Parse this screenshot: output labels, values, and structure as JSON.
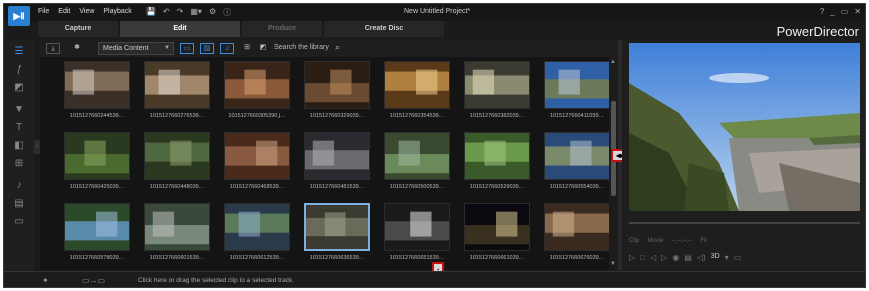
{
  "titlebar": {
    "logo": "▶Ⅱ",
    "menu": [
      "File",
      "Edit",
      "View",
      "Playback"
    ],
    "icons": [
      "💾",
      "↶",
      "↷",
      "▦▾",
      "⚙",
      "ⓘ"
    ],
    "project_title": "New Untitled Project*",
    "window_controls": [
      "?",
      "_",
      "▭",
      "✕"
    ]
  },
  "mode_tabs": [
    {
      "label": "Capture",
      "state": "normal"
    },
    {
      "label": "Edit",
      "state": "active"
    },
    {
      "label": "Produce",
      "state": "disabled"
    },
    {
      "label": "Create Disc",
      "state": "normal"
    }
  ],
  "brand": "PowerDirector",
  "library": {
    "content_type": "Media Content",
    "search_placeholder": "Search the library",
    "media": [
      {
        "caption": "1015127660244539…"
      },
      {
        "caption": "1015127660276539…"
      },
      {
        "caption": "1015127660305390.j…"
      },
      {
        "caption": "1015127660329039…"
      },
      {
        "caption": "1015127660354539…"
      },
      {
        "caption": "1015127660382039…"
      },
      {
        "caption": "1015127660411039…"
      },
      {
        "caption": "1015127660425039…"
      },
      {
        "caption": "1015127660448039…"
      },
      {
        "caption": "1015127660468539…"
      },
      {
        "caption": "1015127660481539…"
      },
      {
        "caption": "1015127660500539…"
      },
      {
        "caption": "1015127660529039…"
      },
      {
        "caption": "1015127660554039…"
      },
      {
        "caption": "1015127660578039…"
      },
      {
        "caption": "1015127660601539…"
      },
      {
        "caption": "1015127660612539…"
      },
      {
        "caption": "1015127660636539…"
      },
      {
        "caption": "1015127660651539…"
      },
      {
        "caption": "1015127660661039…"
      },
      {
        "caption": "1015127660676039…"
      }
    ],
    "selected_index": 17
  },
  "preview": {
    "clip_label": "Clip",
    "movie_label": "Movie",
    "timecode": "--;--;--;--",
    "fit_label": "Fit",
    "mode_3d": "3D"
  },
  "bottom": {
    "hint": "Click here or drag the selected clip to a selected track."
  },
  "colors": {
    "accent": "#3d8bdf",
    "highlight": "#c41010"
  }
}
